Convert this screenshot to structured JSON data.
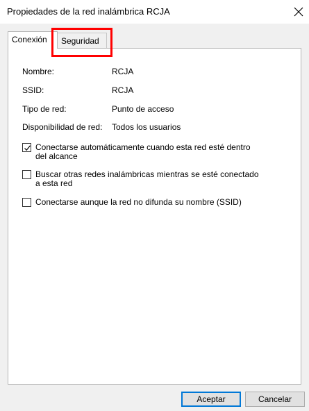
{
  "window": {
    "title": "Propiedades de la red inalámbrica RCJA",
    "close_icon": "×"
  },
  "tabs": [
    {
      "label": "Conexión",
      "active": true
    },
    {
      "label": "Seguridad",
      "active": false,
      "highlighted": true
    }
  ],
  "info": [
    {
      "label": "Nombre:",
      "value": "RCJA"
    },
    {
      "label": "SSID:",
      "value": "RCJA"
    },
    {
      "label": "Tipo de red:",
      "value": "Punto de acceso"
    },
    {
      "label": "Disponibilidad de red:",
      "value": "Todos los usuarios"
    }
  ],
  "options": [
    {
      "line1": "Conectarse automáticamente cuando esta red esté dentro",
      "line2": "del alcance",
      "checked": true
    },
    {
      "line1": "Buscar otras redes inalámbricas mientras se esté conectado",
      "line2": "a esta red",
      "checked": false
    },
    {
      "line1": "Conectarse aunque la red no difunda su nombre (SSID)",
      "checked": false
    }
  ],
  "buttons": {
    "ok": "Aceptar",
    "cancel": "Cancelar"
  },
  "colors": {
    "highlight": "#ff0000",
    "primary_border": "#0078d7"
  }
}
